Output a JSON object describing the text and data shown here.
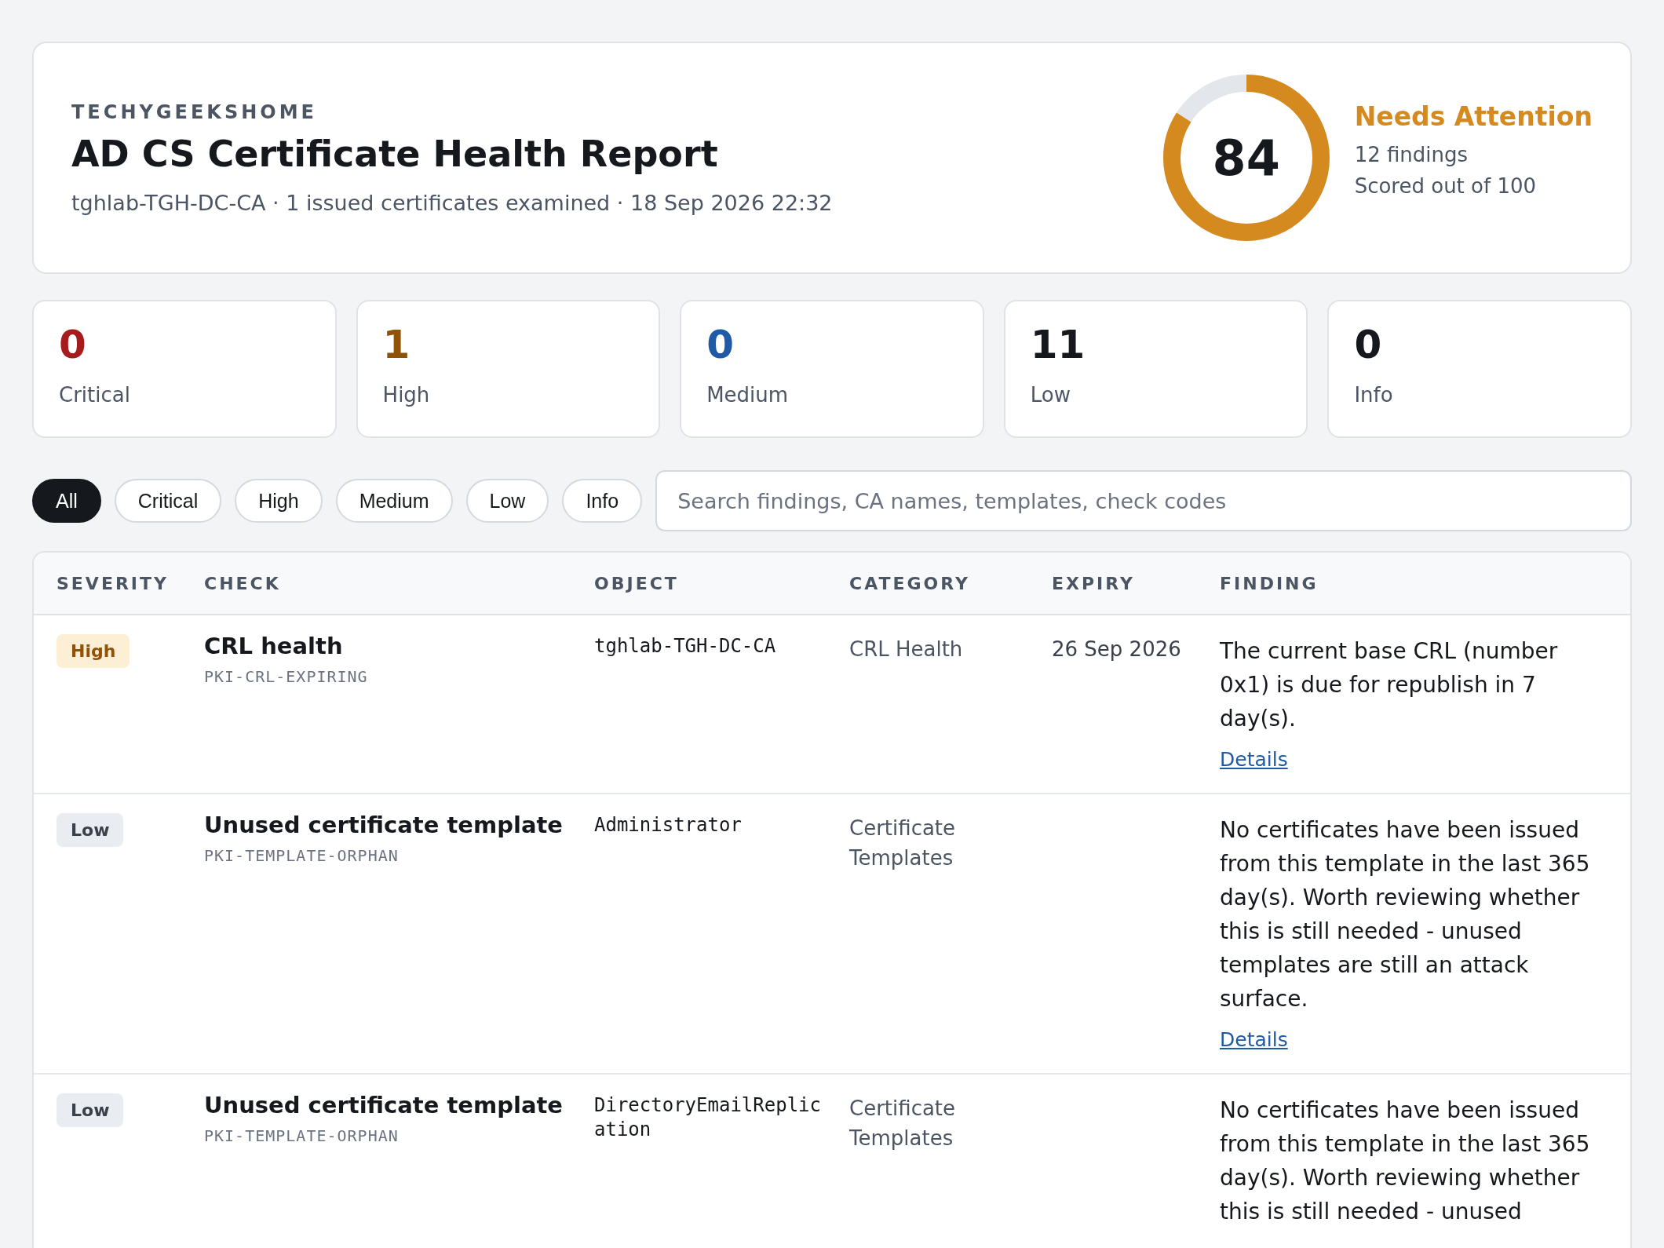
{
  "header": {
    "org": "TECHYGEEKSHOME",
    "title": "AD CS Certificate Health Report",
    "subtitle": "tghlab-TGH-DC-CA · 1 issued certificates examined · 18 Sep 2026 22:32"
  },
  "score": {
    "value": "84",
    "level": 0.84,
    "status": "Needs Attention",
    "findings": "12 findings",
    "note": "Scored out of 100"
  },
  "stats": [
    {
      "count": "0",
      "label": "Critical",
      "color": "#a61b1b"
    },
    {
      "count": "1",
      "label": "High",
      "color": "#8f5206"
    },
    {
      "count": "0",
      "label": "Medium",
      "color": "#1f5aa6"
    },
    {
      "count": "11",
      "label": "Low",
      "color": "#15181d"
    },
    {
      "count": "0",
      "label": "Info",
      "color": "#15181d"
    }
  ],
  "filters": [
    {
      "label": "All",
      "selected": true
    },
    {
      "label": "Critical",
      "selected": false
    },
    {
      "label": "High",
      "selected": false
    },
    {
      "label": "Medium",
      "selected": false
    },
    {
      "label": "Low",
      "selected": false
    },
    {
      "label": "Info",
      "selected": false
    }
  ],
  "search": {
    "placeholder": "Search findings, CA names, templates, check codes"
  },
  "table": {
    "columns": [
      "SEVERITY",
      "CHECK",
      "OBJECT",
      "CATEGORY",
      "EXPIRY",
      "FINDING"
    ],
    "rows": [
      {
        "severity": {
          "label": "High",
          "kind": "high"
        },
        "check": "CRL health",
        "code": "PKI-CRL-EXPIRING",
        "object": "tghlab-TGH-DC-CA",
        "category": "CRL Health",
        "expiry": "26 Sep 2026",
        "finding": "The current base CRL (number 0x1) is due for republish in 7 day(s).",
        "link": "Details"
      },
      {
        "severity": {
          "label": "Low",
          "kind": "low"
        },
        "check": "Unused certificate template",
        "code": "PKI-TEMPLATE-ORPHAN",
        "object": "Administrator",
        "category": "Certificate Templates",
        "finding": "No certificates have been issued from this template in the last 365 day(s). Worth reviewing whether this is still needed - unused templates are still an attack surface.",
        "link": "Details"
      },
      {
        "severity": {
          "label": "Low",
          "kind": "low"
        },
        "check": "Unused certificate template",
        "code": "PKI-TEMPLATE-ORPHAN",
        "object": "DirectoryEmailReplication",
        "category": "Certificate Templates",
        "finding": "No certificates have been issued from this template in the last 365 day(s). Worth reviewing whether this is still needed - unused"
      }
    ]
  }
}
